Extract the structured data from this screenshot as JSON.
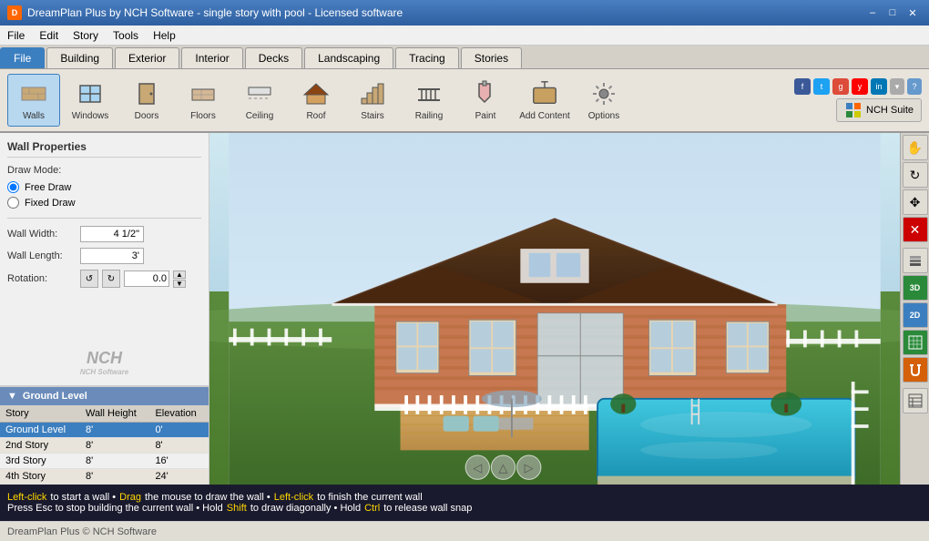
{
  "titlebar": {
    "title": "DreamPlan Plus by NCH Software - single story with pool - Licensed software",
    "icon": "D"
  },
  "menu": {
    "items": [
      "File",
      "Edit",
      "Story",
      "Tools",
      "Help"
    ]
  },
  "tabs": {
    "items": [
      "File",
      "Building",
      "Exterior",
      "Interior",
      "Decks",
      "Landscaping",
      "Tracing",
      "Stories"
    ],
    "active": "Building"
  },
  "toolbar": {
    "tools": [
      {
        "id": "walls",
        "label": "Walls",
        "icon": "🧱",
        "active": true
      },
      {
        "id": "windows",
        "label": "Windows",
        "icon": "🪟",
        "active": false
      },
      {
        "id": "doors",
        "label": "Doors",
        "icon": "🚪",
        "active": false
      },
      {
        "id": "floors",
        "label": "Floors",
        "icon": "▦",
        "active": false
      },
      {
        "id": "ceiling",
        "label": "Ceiling",
        "icon": "⬜",
        "active": false
      },
      {
        "id": "roof",
        "label": "Roof",
        "icon": "🏠",
        "active": false
      },
      {
        "id": "stairs",
        "label": "Stairs",
        "icon": "🪜",
        "active": false
      },
      {
        "id": "railing",
        "label": "Railing",
        "icon": "⊞",
        "active": false
      },
      {
        "id": "paint",
        "label": "Paint",
        "icon": "🎨",
        "active": false
      },
      {
        "id": "add-content",
        "label": "Add Content",
        "icon": "📦",
        "active": false
      },
      {
        "id": "options",
        "label": "Options",
        "icon": "⚙",
        "active": false
      }
    ],
    "nch_suite": "NCH Suite"
  },
  "wall_properties": {
    "title": "Wall Properties",
    "draw_mode_label": "Draw Mode:",
    "free_draw_label": "Free Draw",
    "fixed_draw_label": "Fixed Draw",
    "wall_width_label": "Wall Width:",
    "wall_width_value": "4 1/2\"",
    "wall_length_label": "Wall Length:",
    "wall_length_value": "3'",
    "rotation_label": "Rotation:",
    "rotation_value": "0.0"
  },
  "nch_logo": "NCH",
  "ground_level": {
    "title": "Ground Level",
    "columns": [
      "Story",
      "Wall Height",
      "Elevation"
    ],
    "rows": [
      {
        "story": "Ground Level",
        "wall_height": "8'",
        "elevation": "0'",
        "selected": true
      },
      {
        "story": "2nd Story",
        "wall_height": "8'",
        "elevation": "8'",
        "selected": false
      },
      {
        "story": "3rd Story",
        "wall_height": "8'",
        "elevation": "16'",
        "selected": false
      },
      {
        "story": "4th Story",
        "wall_height": "8'",
        "elevation": "24'",
        "selected": false
      }
    ]
  },
  "status": {
    "line1_parts": [
      {
        "text": "Left-click",
        "style": "yellow"
      },
      {
        "text": " to start a wall • ",
        "style": "white"
      },
      {
        "text": "Drag",
        "style": "yellow"
      },
      {
        "text": " the mouse to draw the wall • ",
        "style": "white"
      },
      {
        "text": "Left-click",
        "style": "yellow"
      },
      {
        "text": " to finish the current wall",
        "style": "white"
      }
    ],
    "line2_parts": [
      {
        "text": "Press Esc to stop building the current wall • Hold ",
        "style": "white"
      },
      {
        "text": "Shift",
        "style": "yellow"
      },
      {
        "text": " to draw diagonally • Hold ",
        "style": "white"
      },
      {
        "text": "Ctrl",
        "style": "yellow"
      },
      {
        "text": " to release wall snap",
        "style": "white"
      }
    ]
  },
  "right_toolbar": {
    "buttons": [
      {
        "id": "hand",
        "icon": "✋",
        "style": "normal"
      },
      {
        "id": "orbit",
        "icon": "↻",
        "style": "normal"
      },
      {
        "id": "pan",
        "icon": "✥",
        "style": "normal"
      },
      {
        "id": "close-x",
        "icon": "✕",
        "style": "special"
      },
      {
        "id": "layers",
        "icon": "▤",
        "style": "normal"
      },
      {
        "id": "view3d",
        "icon": "■",
        "style": "green"
      },
      {
        "id": "view2d",
        "icon": "2D",
        "style": "blue-btn"
      },
      {
        "id": "grid",
        "icon": "⊞",
        "style": "green"
      },
      {
        "id": "magnet",
        "icon": "⊕",
        "style": "orange"
      },
      {
        "id": "table",
        "icon": "▦",
        "style": "normal"
      }
    ]
  },
  "footer": {
    "text": "DreamPlan Plus © NCH Software"
  },
  "social": {
    "icons": [
      {
        "id": "fb",
        "color": "#3b5998",
        "letter": "f"
      },
      {
        "id": "tw",
        "color": "#1da1f2",
        "letter": "t"
      },
      {
        "id": "gp",
        "color": "#dd4b39",
        "letter": "g"
      },
      {
        "id": "yt",
        "color": "#ff0000",
        "letter": "y"
      },
      {
        "id": "li",
        "color": "#0077b5",
        "letter": "in"
      }
    ]
  }
}
